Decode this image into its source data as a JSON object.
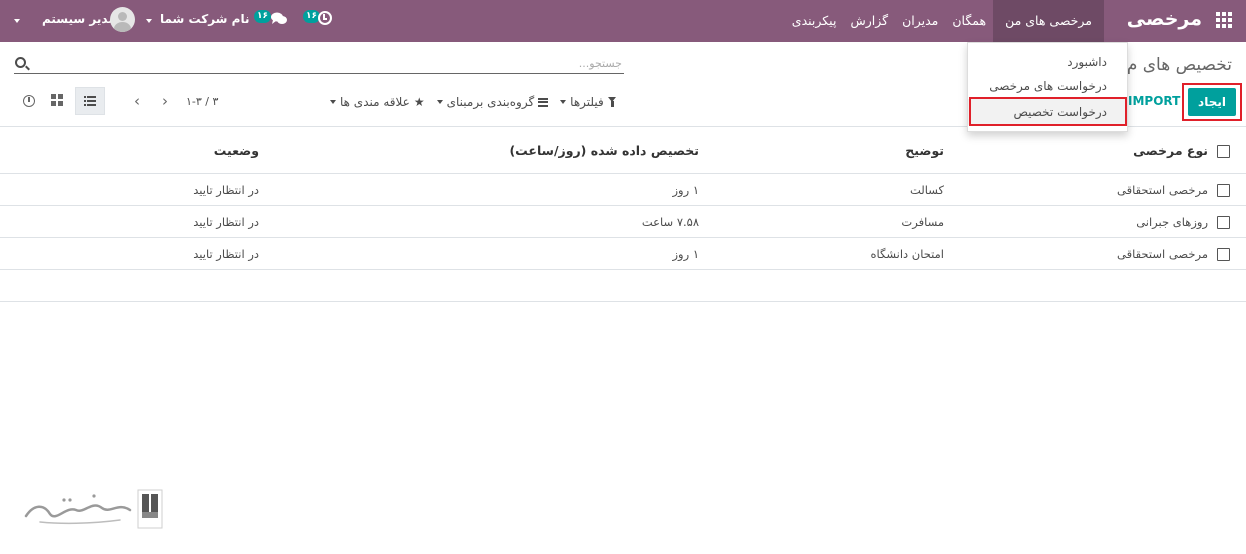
{
  "navbar": {
    "brand": "مرخصی",
    "menu": [
      {
        "label": "مرخصی های من",
        "active": true
      },
      {
        "label": "همگان",
        "active": false
      },
      {
        "label": "مدیران",
        "active": false
      },
      {
        "label": "گزارش",
        "active": false
      },
      {
        "label": "پیکربندی",
        "active": false
      }
    ],
    "user_name": "مدیر سیستم",
    "company_name": "نام شرکت شما",
    "messages_badge": "۱۶",
    "activities_badge": "۱۶",
    "accent_color": "#875a7b"
  },
  "dropdown": {
    "items": [
      {
        "label": "داشبورد"
      },
      {
        "label": "درخواست های مرخصی"
      },
      {
        "label": "درخواست تخصیص",
        "selected": true
      }
    ]
  },
  "control_panel": {
    "breadcrumb": "تخصیص های م",
    "search_placeholder": "جستجو...",
    "create_label": "ایجاد",
    "import_label": "IMPORT",
    "filters_label": "فیلترها",
    "groupby_label": "گروه‌بندی برمبنای",
    "favorites_label": "علاقه مندی ها",
    "pager": "۱-۳ / ۳",
    "primary_color": "#00a09d"
  },
  "table": {
    "headers": {
      "type": "نوع مرخصی",
      "description": "توضیح",
      "allocated": "تخصیص داده شده (روز/ساعت)",
      "state": "وضعیت"
    },
    "rows": [
      {
        "type": "مرخصی استحقاقی",
        "description": "کسالت",
        "allocated": "۱ روز",
        "state": "در انتظار تایید"
      },
      {
        "type": "روزهای جبرانی",
        "description": "مسافرت",
        "allocated": "۷.۵۸ ساعت",
        "state": "در انتظار تایید"
      },
      {
        "type": "مرخصی استحقاقی",
        "description": "امتحان دانشگاه",
        "allocated": "۱ روز",
        "state": "در انتظار تایید"
      }
    ]
  }
}
